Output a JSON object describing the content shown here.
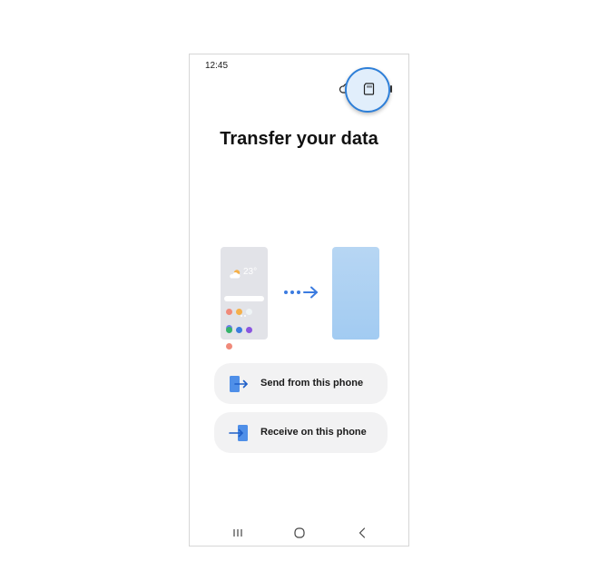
{
  "status_bar": {
    "time": "12:45"
  },
  "title": "Transfer your data",
  "illustration": {
    "weather_temp": "23°",
    "app_dot_colors": [
      "#f08a7a",
      "#f5b04a",
      "#e7f0f3",
      "#6f7ee8",
      "#34b36a",
      "#3b7be0",
      "#8a55e0",
      "#f08a7a"
    ],
    "accent_color": "#3b7be0"
  },
  "actions": [
    {
      "label": "Send from this phone",
      "icon": "phone-send-icon"
    },
    {
      "label": "Receive on this phone",
      "icon": "phone-receive-icon"
    }
  ],
  "toolbar": {
    "cloud_icon": "cloud-icon",
    "sd_card_icon": "sd-card-icon"
  },
  "nav": {
    "recents_icon": "recents-icon",
    "home_icon": "home-icon",
    "back_icon": "back-icon"
  }
}
